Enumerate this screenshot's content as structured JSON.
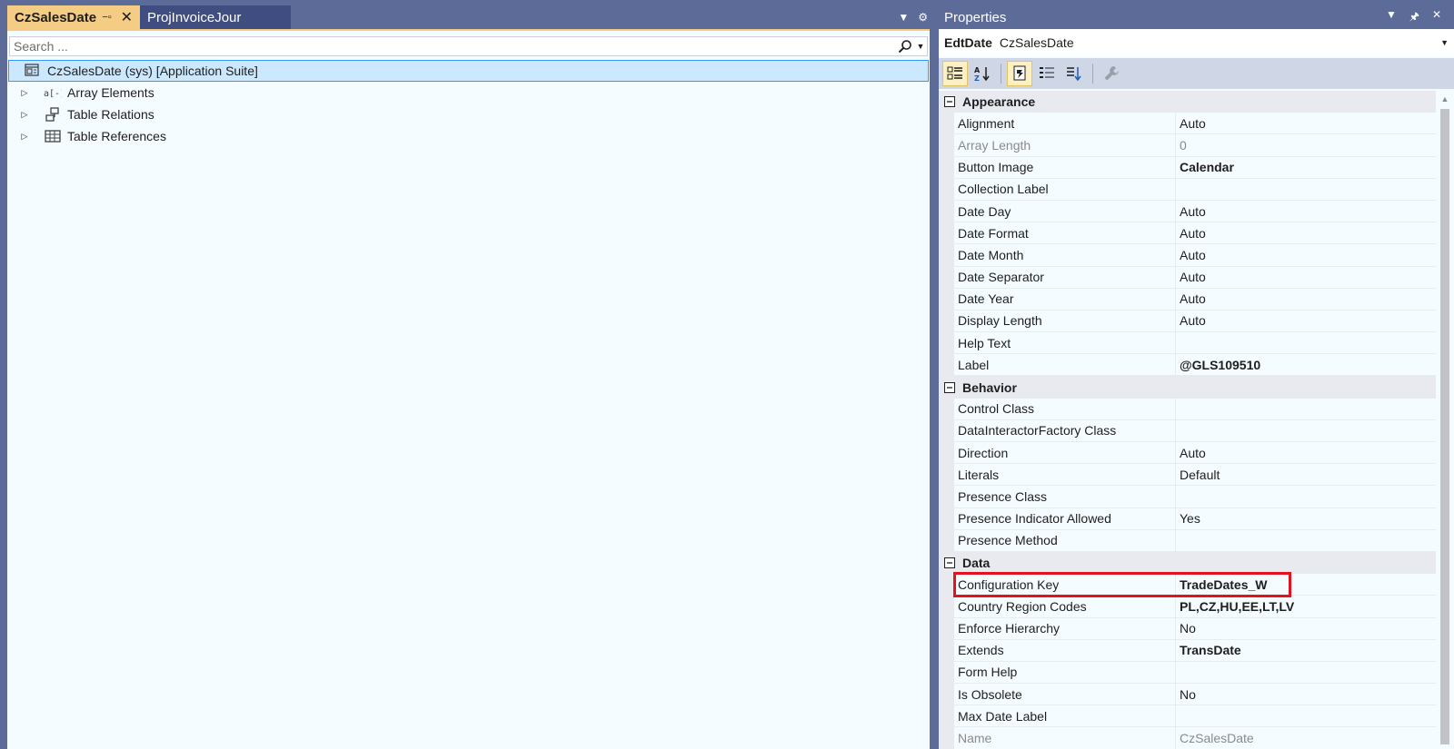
{
  "document_tabs": [
    {
      "label": "CzSalesDate",
      "active": true
    },
    {
      "label": "ProjInvoiceJour",
      "active": false
    }
  ],
  "explorer": {
    "search_placeholder": "Search ...",
    "root_label": "CzSalesDate (sys) [Application Suite]",
    "items": [
      {
        "label": "Array Elements",
        "icon": "array-elements-icon"
      },
      {
        "label": "Table Relations",
        "icon": "table-relations-icon"
      },
      {
        "label": "Table References",
        "icon": "table-references-icon"
      }
    ]
  },
  "properties": {
    "title": "Properties",
    "object_type": "EdtDate",
    "object_name": "CzSalesDate",
    "categories": [
      {
        "name": "Appearance",
        "rows": [
          {
            "name": "Alignment",
            "value": "Auto"
          },
          {
            "name": "Array Length",
            "value": "0"
          },
          {
            "name": "Button Image",
            "value": "Calendar"
          },
          {
            "name": "Collection Label",
            "value": ""
          },
          {
            "name": "Date Day",
            "value": "Auto"
          },
          {
            "name": "Date Format",
            "value": "Auto"
          },
          {
            "name": "Date Month",
            "value": "Auto"
          },
          {
            "name": "Date Separator",
            "value": "Auto"
          },
          {
            "name": "Date Year",
            "value": "Auto"
          },
          {
            "name": "Display Length",
            "value": "Auto"
          },
          {
            "name": "Help Text",
            "value": ""
          },
          {
            "name": "Label",
            "value": "@GLS109510"
          }
        ]
      },
      {
        "name": "Behavior",
        "rows": [
          {
            "name": "Control Class",
            "value": ""
          },
          {
            "name": "DataInteractorFactory Class",
            "value": ""
          },
          {
            "name": "Direction",
            "value": "Auto"
          },
          {
            "name": "Literals",
            "value": "Default"
          },
          {
            "name": "Presence Class",
            "value": ""
          },
          {
            "name": "Presence Indicator Allowed",
            "value": "Yes"
          },
          {
            "name": "Presence Method",
            "value": ""
          }
        ]
      },
      {
        "name": "Data",
        "rows": [
          {
            "name": "Configuration Key",
            "value": "TradeDates_W"
          },
          {
            "name": "Country Region Codes",
            "value": "PL,CZ,HU,EE,LT,LV"
          },
          {
            "name": "Enforce Hierarchy",
            "value": "No"
          },
          {
            "name": "Extends",
            "value": "TransDate"
          },
          {
            "name": "Form Help",
            "value": ""
          },
          {
            "name": "Is Obsolete",
            "value": "No"
          },
          {
            "name": "Max Date Label",
            "value": ""
          },
          {
            "name": "Name",
            "value": "CzSalesDate"
          }
        ]
      }
    ]
  },
  "colors": {
    "active_tab": "#f5cc84",
    "chrome": "#5d6b99",
    "selection": "#cce8ff",
    "highlight_box": "#e2131e"
  }
}
